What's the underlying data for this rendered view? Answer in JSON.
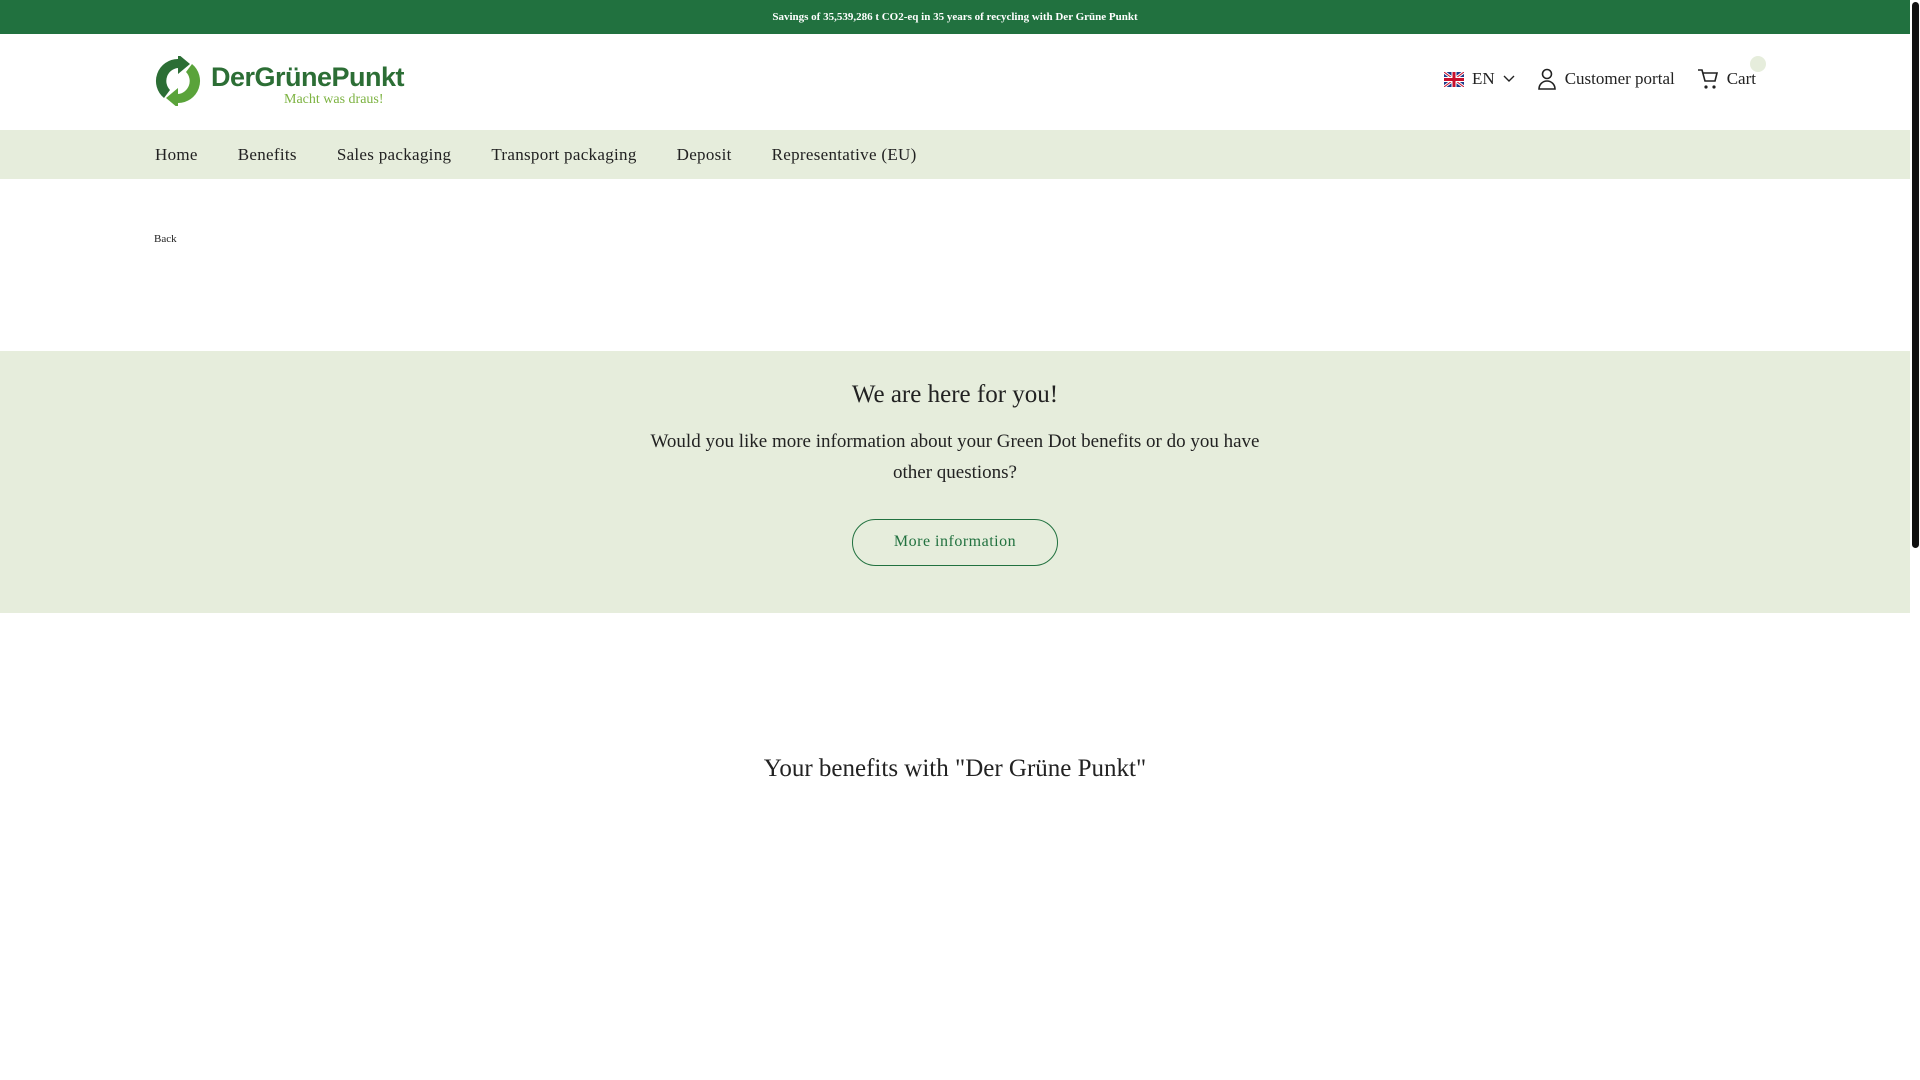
{
  "topbar": {
    "text": "Savings of 35,539,286 t CO2-eq in 35 years of recycling with Der Grüne Punkt"
  },
  "logo": {
    "main": "DerGrünePunkt",
    "tagline": "Macht was draus!"
  },
  "header": {
    "language": "EN",
    "customer_portal": "Customer portal",
    "cart": "Cart"
  },
  "nav": {
    "items": [
      "Home",
      "Benefits",
      "Sales packaging",
      "Transport packaging",
      "Deposit",
      "Representative (EU)"
    ]
  },
  "back": {
    "label": " Back"
  },
  "contact": {
    "title": "We are here for you!",
    "text": "Would you like more information about your Green Dot benefits or do you have other questions?",
    "button": "More information"
  },
  "benefits": {
    "title": "Your benefits with \"Der Grüne Punkt\""
  },
  "colors": {
    "brand": "#21713f",
    "light": "#e6eddc",
    "accent": "#7db342"
  }
}
